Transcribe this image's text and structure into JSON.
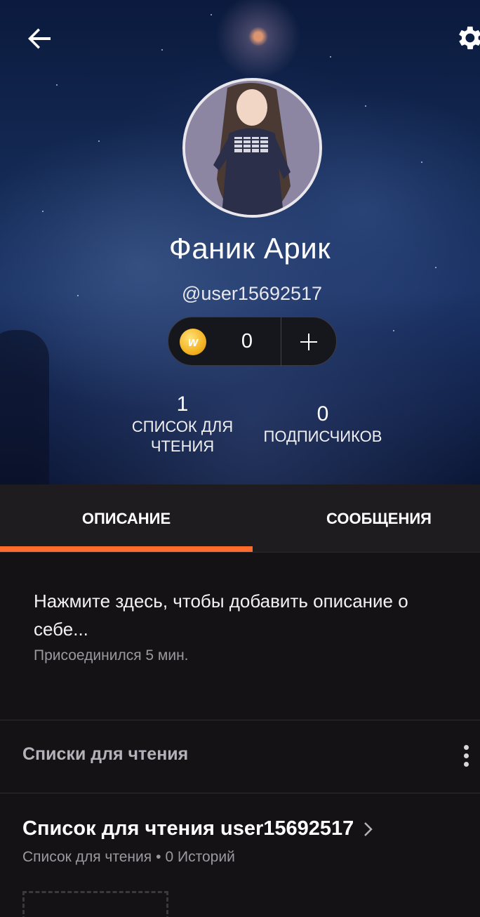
{
  "header": {
    "back_icon": "arrow-left-icon",
    "settings_icon": "gear-icon",
    "display_name": "Фаник Арик",
    "username": "@user15692517",
    "coins": "0",
    "coin_icon": "coin-w-icon",
    "coin_letter": "w",
    "add_icon": "plus-icon"
  },
  "stats": {
    "reading_lists": {
      "count": "1",
      "label_line1": "СПИСОК ДЛЯ",
      "label_line2": "ЧТЕНИЯ"
    },
    "followers": {
      "count": "0",
      "label": "ПОДПИСЧИКОВ"
    }
  },
  "tabs": [
    {
      "label": "ОПИСАНИЕ",
      "active": true
    },
    {
      "label": "СООБЩЕНИЯ",
      "active": false
    }
  ],
  "about": {
    "prompt": "Нажмите здесь, чтобы добавить описание о себе...",
    "joined": "Присоединился 5 мин."
  },
  "reading_lists_section": {
    "header": "Списки для чтения",
    "more_icon": "kebab-menu-icon",
    "list_title": "Список для чтения user15692517",
    "list_type": "Список для чтения",
    "list_count": "0 Историй"
  },
  "colors": {
    "accent": "#ff6b2c",
    "background": "#141215",
    "tab_bar": "#1e1c1f",
    "secondary_text": "#9a999f"
  }
}
